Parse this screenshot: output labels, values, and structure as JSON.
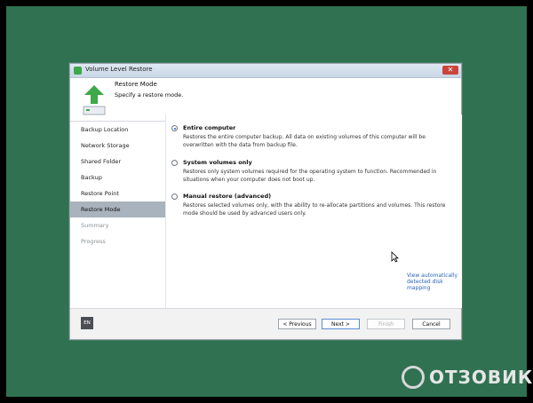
{
  "window": {
    "title": "Volume Level Restore",
    "close_glyph": "✕"
  },
  "header": {
    "title": "Restore Mode",
    "subtitle": "Specify a restore mode."
  },
  "sidebar": {
    "items": [
      {
        "label": "Backup Location"
      },
      {
        "label": "Network Storage"
      },
      {
        "label": "Shared Folder"
      },
      {
        "label": "Backup"
      },
      {
        "label": "Restore Point"
      },
      {
        "label": "Restore Mode"
      },
      {
        "label": "Summary"
      },
      {
        "label": "Progress"
      }
    ]
  },
  "options": [
    {
      "title": "Entire computer",
      "desc": "Restores the entire computer backup. All data on existing volumes of this computer will be overwritten with the data from backup file.",
      "checked": true
    },
    {
      "title": "System volumes only",
      "desc": "Restores only system volumes required for the operating system to function. Recommended in situations when your computer does not boot up.",
      "checked": false
    },
    {
      "title": "Manual restore (advanced)",
      "desc": "Restores selected volumes only, with the ability to re-allocate partitions and volumes. This restore mode should be used by advanced users only.",
      "checked": false
    }
  ],
  "link": {
    "label": "View automatically detected disk mapping"
  },
  "footer": {
    "lang": "EN",
    "previous": "< Previous",
    "next": "Next >",
    "finish": "Finish",
    "cancel": "Cancel"
  },
  "watermark": {
    "text": "ОТЗОВИК"
  },
  "colors": {
    "accent": "#3ea84a",
    "desktop": "#2f7150",
    "active_nav": "#a9b3bd",
    "link": "#2a63b5"
  }
}
